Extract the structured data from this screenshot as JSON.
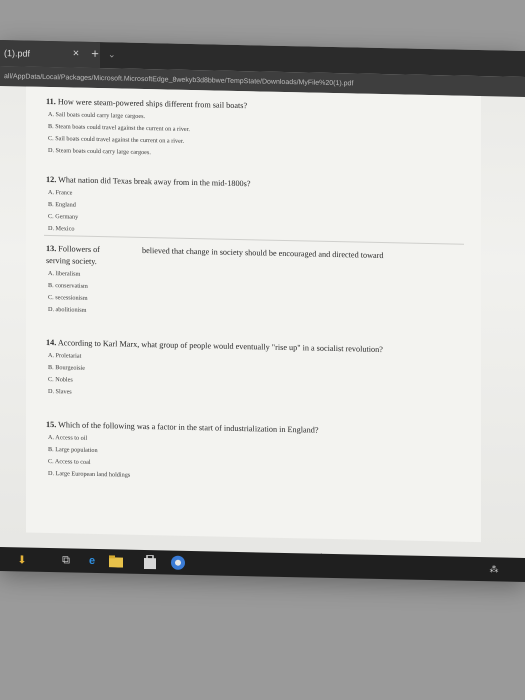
{
  "browser": {
    "tab_title": "(1).pdf",
    "tab_close": "×",
    "new_tab": "+",
    "tab_dropdown": "⌄",
    "address": "all/AppData/Local/Packages/Microsoft.MicrosoftEdge_8wekyb3d8bbwe/TempState/Downloads/MyFile%20(1).pdf"
  },
  "questions": [
    {
      "num": "11.",
      "text": "How were steam-powered ships different from sail boats?",
      "options": [
        "A. Sail boats could carry large cargoes.",
        "B. Steam boats could travel against the current on a river.",
        "C. Sail boats could travel against the current on a river.",
        "D. Steam boats could carry large cargoes."
      ]
    },
    {
      "num": "12.",
      "text": "What nation did Texas break away from in the mid-1800s?",
      "options": [
        "A. France",
        "B. England",
        "C. Germany",
        "D. Mexico"
      ]
    },
    {
      "num": "13.",
      "text_a": "Followers of",
      "text_b": "believed that change in society should be encouraged and directed toward",
      "text_c": "serving society.",
      "options": [
        "A. liberalism",
        "B. conservatism",
        "C. secessionism",
        "D. abolitionism"
      ]
    },
    {
      "num": "14.",
      "text": "According to Karl Marx, what group of people would eventually \"rise up\" in a socialist revolution?",
      "options": [
        "A. Proletariat",
        "B. Bourgeoisie",
        "C. Nobles",
        "D. Slaves"
      ]
    },
    {
      "num": "15.",
      "text": "Which of the following was a factor in the start of industrialization in England?",
      "options": [
        "A. Access to oil",
        "B. Large population",
        "C. Access to coal",
        "D. Large European land holdings"
      ]
    }
  ],
  "taskbar": {
    "icons": [
      "download-icon",
      "taskview-icon",
      "edge-icon",
      "file-explorer-icon",
      "store-icon",
      "chrome-icon"
    ],
    "tray": "⁂",
    "colors": {
      "edge": "#2f8fe0",
      "explorer": "#e8c24a",
      "store": "#d8d8d8",
      "chrome": "#3a7bd5"
    }
  }
}
